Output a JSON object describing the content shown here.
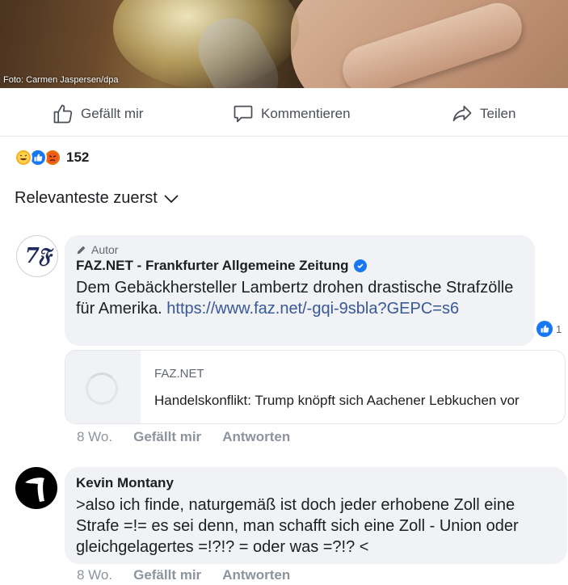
{
  "photo": {
    "credit": "Foto: Carmen Jaspersen/dpa"
  },
  "actions": {
    "like": "Gefällt mir",
    "comment": "Kommentieren",
    "share": "Teilen"
  },
  "reactions": {
    "count": "152",
    "icons": [
      "haha-icon",
      "like-icon",
      "angry-icon"
    ]
  },
  "sort": {
    "label": "Relevanteste zuerst"
  },
  "comments": [
    {
      "author_tag": "Autor",
      "name": "FAZ.NET - Frankfurter Allgemeine Zeitung",
      "verified": true,
      "text": "Dem Gebäckhersteller Lambertz drohen drastische Strafzölle für Amerika.",
      "link": "https://www.faz.net/-gqi-9sbla?GEPC=s6",
      "like_count": "1",
      "preview": {
        "domain": "FAZ.NET",
        "title": "Handelskonflikt: Trump knöpft sich Aachener Lebkuchen vor"
      },
      "time": "8 Wo.",
      "like_label": "Gefällt mir",
      "reply_label": "Antworten"
    },
    {
      "name": "Kevin Montany",
      "text": ">also ich finde, naturgemäß ist doch  jeder erhobene Zoll eine Strafe =!= es sei denn, man schafft sich eine Zoll - Union oder gleichgelagertes =!?!? = oder was =?!? <",
      "time": "8 Wo.",
      "like_label": "Gefällt mir",
      "reply_label": "Antworten"
    }
  ],
  "colors": {
    "link": "#385898",
    "brand": "#1877f2",
    "muted": "#8d949e",
    "bubble": "#f0f2f5"
  }
}
